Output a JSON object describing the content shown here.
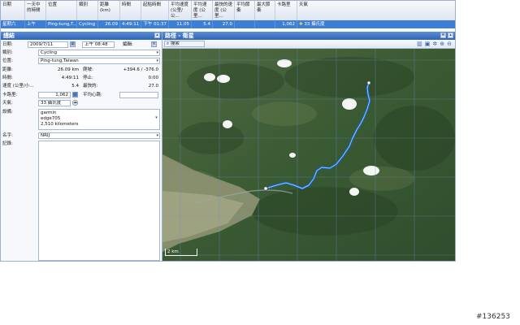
{
  "table": {
    "headers": [
      "日期",
      "一天中的時間",
      "位置",
      "類別",
      "距離 (km)",
      "時間",
      "起點時間",
      "平均速度 (公里/公...",
      "平均速度 (公里...",
      "最快的速度 (公里...",
      "平均節奏",
      "最大節奏",
      "卡路里",
      "天氣"
    ],
    "row": [
      "星期六",
      "上午",
      "Ping-tung,T...",
      "Cycling",
      "26.09",
      "4:49:11",
      "下午 01:37",
      "11.05",
      "5.4",
      "27.0",
      "",
      "",
      "1,062",
      "33 攝氏度"
    ]
  },
  "summary": {
    "title": "總結",
    "date_label": "日期:",
    "date_value": "2009/7/11",
    "time_value": "上午 08:48",
    "edit_label": "編輯:",
    "category_label": "類別:",
    "category_value": "Cycling",
    "location_label": "位置:",
    "location_value": "Ping-tung,Taiwan",
    "distance_label": "距離:",
    "distance_value": "26.09 km",
    "climb_label": "爬坡:",
    "climb_value": "+394.6 / -376.0",
    "time_label": "時間:",
    "time_value2": "4:49:11",
    "stop_label": "停止:",
    "stop_value": "0:00",
    "speed_label": "速度 (公里/小...",
    "speed_value": "5.4",
    "max_label": "最快的:",
    "max_value": "27.0",
    "calories_label": "卡路里:",
    "calories_value": "1,062",
    "hr_label": "平均心跳:",
    "weather_label": "天氣:",
    "weather_value": "33 攝氏度",
    "equipment_label": "設備:",
    "equipment_lines": [
      "garmin",
      "edge705",
      "2,510 kilometers"
    ],
    "name_label": "名字:",
    "name_value": "NRIJ",
    "notes_label": "記錄:"
  },
  "map": {
    "title": "路徑 - 衛星",
    "search_label": "搜索",
    "scale_label": "2 km"
  },
  "watermark": "#136253"
}
